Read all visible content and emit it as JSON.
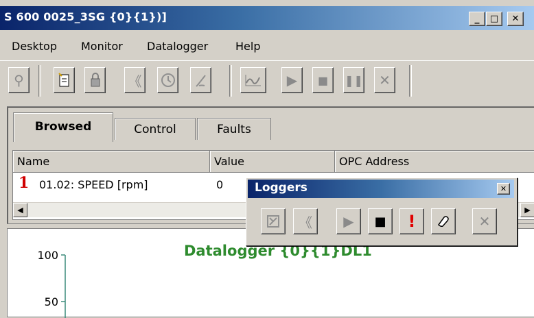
{
  "window": {
    "title": "S 600 0025_3SG {0}{1})]",
    "controls": {
      "minimize": "_",
      "maximize": "□",
      "close": "✕"
    }
  },
  "menu": {
    "items": [
      {
        "label": "Desktop"
      },
      {
        "label": "Monitor"
      },
      {
        "label": "Datalogger"
      },
      {
        "label": "Help"
      }
    ]
  },
  "toolbar": {
    "icons": [
      "search-icon",
      "new-document-icon",
      "lock-icon",
      "rewind-icon",
      "clock-icon",
      "edit-icon",
      "graph-icon",
      "play-icon",
      "stop-icon",
      "pause-icon",
      "close-icon"
    ]
  },
  "tabs": [
    {
      "label": "Browsed",
      "active": true
    },
    {
      "label": "Control",
      "active": false
    },
    {
      "label": "Faults",
      "active": false
    }
  ],
  "table": {
    "columns": [
      "Name",
      "Value",
      "OPC Address"
    ],
    "rows": [
      {
        "index": "1",
        "name": "01.02: SPEED [rpm]",
        "value": "0",
        "opc_address": ""
      }
    ]
  },
  "loggers_window": {
    "title": "Loggers",
    "close": "✕",
    "icons": [
      "properties-icon",
      "rewind-icon",
      "play-icon",
      "stop-icon",
      "trigger-icon",
      "eraser-icon",
      "close-icon"
    ]
  },
  "chart_data": {
    "type": "line",
    "title": "Datalogger {0}{1}DL1",
    "y_ticks": [
      100,
      50
    ],
    "colors": {
      "title": "#2e8b2e",
      "axis": "#3a8a7a"
    }
  }
}
